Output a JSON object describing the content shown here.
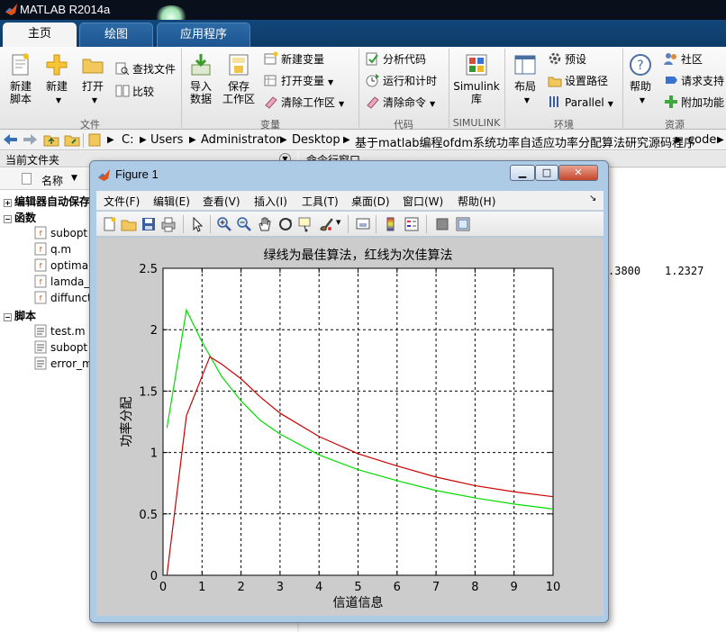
{
  "app": {
    "title": "MATLAB R2014a"
  },
  "tabs": [
    {
      "label": "主页",
      "active": true
    },
    {
      "label": "绘图",
      "active": false
    },
    {
      "label": "应用程序",
      "active": false
    }
  ],
  "ribbon": {
    "new_script": "新建\n脚本",
    "new": "新建",
    "open": "打开",
    "find_files": "查找文件",
    "compare": "比较",
    "import_data": "导入\n数据",
    "save_workspace": "保存\n工作区",
    "new_variable": "新建变量",
    "open_variable": "打开变量",
    "clear_workspace": "清除工作区",
    "analyze_code": "分析代码",
    "run_and_time": "运行和计时",
    "clear_commands": "清除命令",
    "simulink_library": "Simulink\n库",
    "layout": "布局",
    "preferences": "预设",
    "set_path": "设置路径",
    "parallel": "Parallel",
    "help": "帮助",
    "community": "社区",
    "request_support": "请求支持",
    "add_ons": "附加功能",
    "sections": {
      "file": "文件",
      "variable": "变量",
      "code": "代码",
      "simulink": "SIMULINK",
      "environment": "环境",
      "resources": "资源"
    }
  },
  "address": {
    "parts": [
      "C:",
      "Users",
      "Administrator",
      "Desktop",
      "基于matlab编程ofdm系统功率自适应功率分配算法研究源码程序",
      "code"
    ]
  },
  "current_folder": {
    "title": "当前文件夹",
    "name_col": "名称",
    "groups": [
      {
        "label": "编辑器自动保存",
        "expanded": false
      },
      {
        "label": "函数",
        "expanded": true
      },
      {
        "label": "脚本",
        "expanded": true
      }
    ],
    "functions": [
      "subopt",
      "q.m",
      "optima",
      "lamda_",
      "diffunct"
    ],
    "scripts": [
      "test.m",
      "subopt",
      "error_m"
    ]
  },
  "command_window": {
    "title": "命令行窗口",
    "values": [
      ".3800",
      "1.2327"
    ]
  },
  "figure": {
    "title": "Figure 1",
    "menu": [
      "文件(F)",
      "编辑(E)",
      "查看(V)",
      "插入(I)",
      "工具(T)",
      "桌面(D)",
      "窗口(W)",
      "帮助(H)"
    ],
    "window_buttons": {
      "minimize": "▁",
      "maximize": "□",
      "close": "✕"
    }
  },
  "chart_data": {
    "type": "line",
    "title": "绿线为最佳算法，红线为次佳算法",
    "xlabel": "信道信息",
    "ylabel": "功率分配",
    "xlim": [
      0,
      10
    ],
    "ylim": [
      0,
      2.5
    ],
    "xticks": [
      "0",
      "1",
      "2",
      "3",
      "4",
      "5",
      "6",
      "7",
      "8",
      "9",
      "10"
    ],
    "yticks": [
      "0",
      "0.5",
      "1",
      "1.5",
      "2",
      "2.5"
    ],
    "grid": true,
    "series": [
      {
        "color": "#00dd00",
        "x": [
          0.1,
          0.6,
          1.0,
          1.5,
          2.0,
          2.5,
          3.0,
          4.0,
          5.0,
          6.0,
          7.0,
          8.0,
          9.0,
          10.0
        ],
        "y": [
          1.2,
          2.16,
          1.9,
          1.62,
          1.42,
          1.26,
          1.15,
          0.98,
          0.86,
          0.77,
          0.69,
          0.63,
          0.58,
          0.54
        ]
      },
      {
        "color": "#cc0000",
        "x": [
          0.1,
          0.6,
          1.2,
          1.5,
          2.0,
          2.5,
          3.0,
          4.0,
          5.0,
          6.0,
          7.0,
          8.0,
          9.0,
          10.0
        ],
        "y": [
          0.0,
          1.3,
          1.78,
          1.72,
          1.6,
          1.45,
          1.32,
          1.13,
          0.99,
          0.89,
          0.8,
          0.73,
          0.68,
          0.64
        ]
      }
    ]
  }
}
